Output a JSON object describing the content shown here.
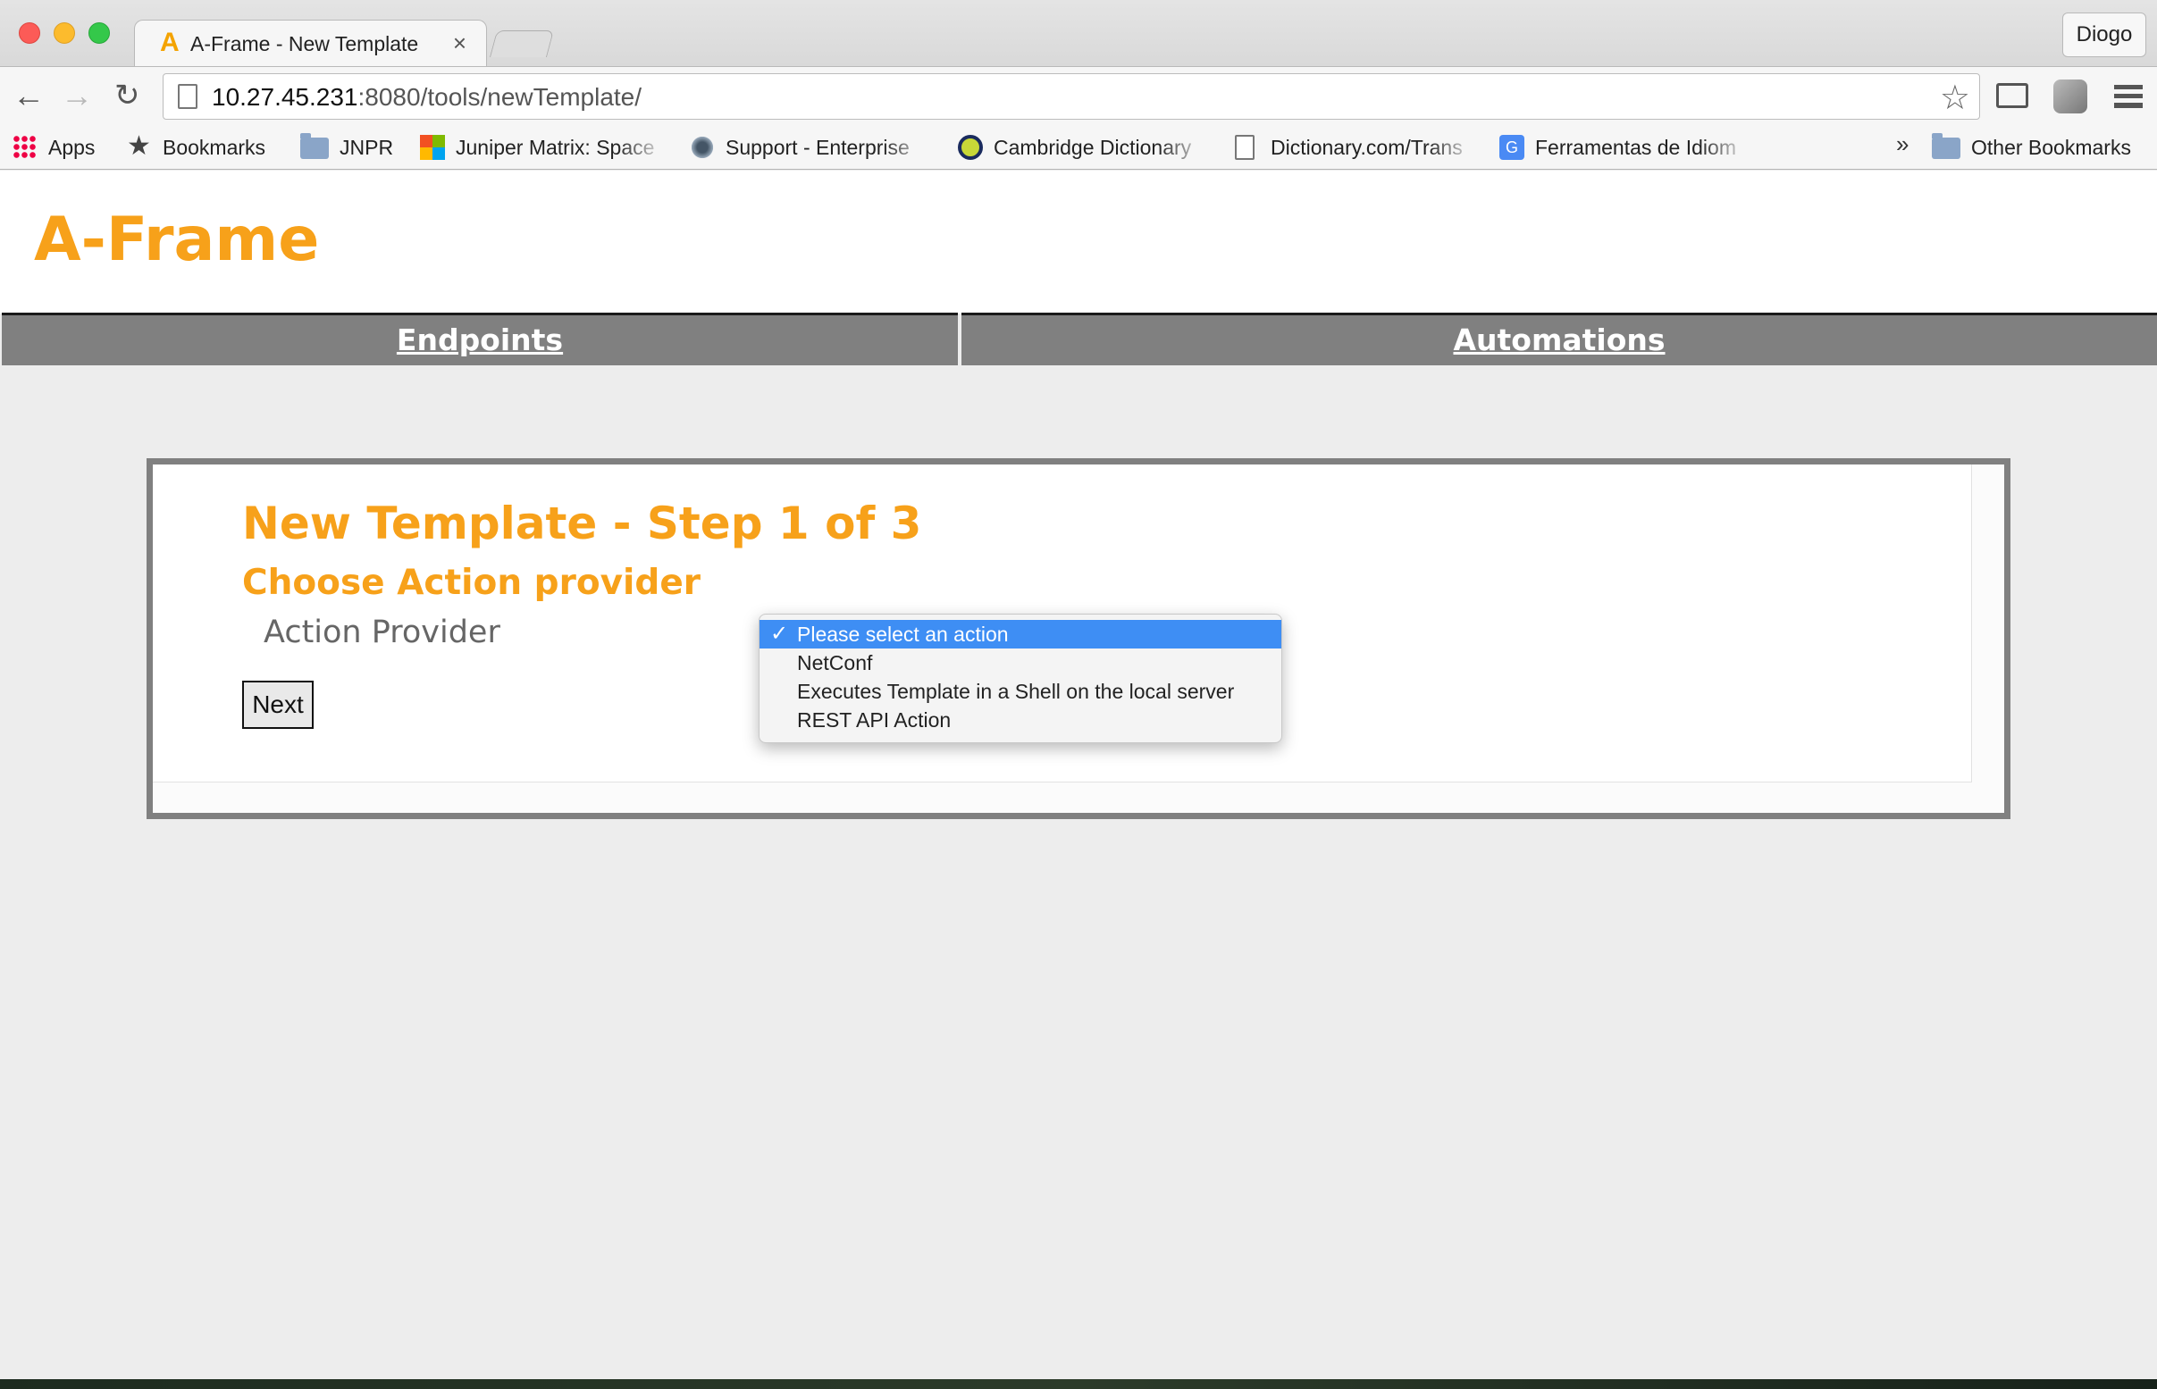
{
  "browser": {
    "tab_title": "A-Frame - New Template",
    "tab_favicon": "A",
    "tab_close": "×",
    "profile_name": "Diogo",
    "url_host": "10.27.45.231",
    "url_path": ":8080/tools/newTemplate/",
    "icons": {
      "back": "←",
      "forward": "→",
      "reload": "↻",
      "star": "☆"
    }
  },
  "bookmarks": {
    "items": [
      {
        "label": "Apps",
        "icon": "apps-grid-icon"
      },
      {
        "label": "Bookmarks",
        "icon": "star-icon"
      },
      {
        "label": "JNPR",
        "icon": "folder-icon"
      },
      {
        "label": "Juniper Matrix: Space",
        "icon": "windows-logo-icon"
      },
      {
        "label": "Support - Enterprise",
        "icon": "globe-icon"
      },
      {
        "label": "Cambridge Dictionary",
        "icon": "cambridge-logo-icon"
      },
      {
        "label": "Dictionary.com/Trans",
        "icon": "page-icon"
      },
      {
        "label": "Ferramentas de Idiom",
        "icon": "google-translate-icon"
      }
    ],
    "overflow": "»",
    "other": "Other Bookmarks"
  },
  "site": {
    "logo": "A-Frame",
    "nav": [
      "Endpoints",
      "Automations"
    ]
  },
  "form": {
    "title": "New Template - Step 1 of 3",
    "subtitle": "Choose Action provider",
    "field_label": "Action Provider",
    "next_label": "Next",
    "options": [
      "Please select an action",
      "NetConf",
      "Executes Template in a Shell on the local server",
      "REST API Action"
    ],
    "selected_option": "Please select an action",
    "check_mark": "✓"
  },
  "colors": {
    "brand_orange": "#f7a11a",
    "nav_gray": "#808080",
    "selection_blue": "#3e8ef4"
  }
}
